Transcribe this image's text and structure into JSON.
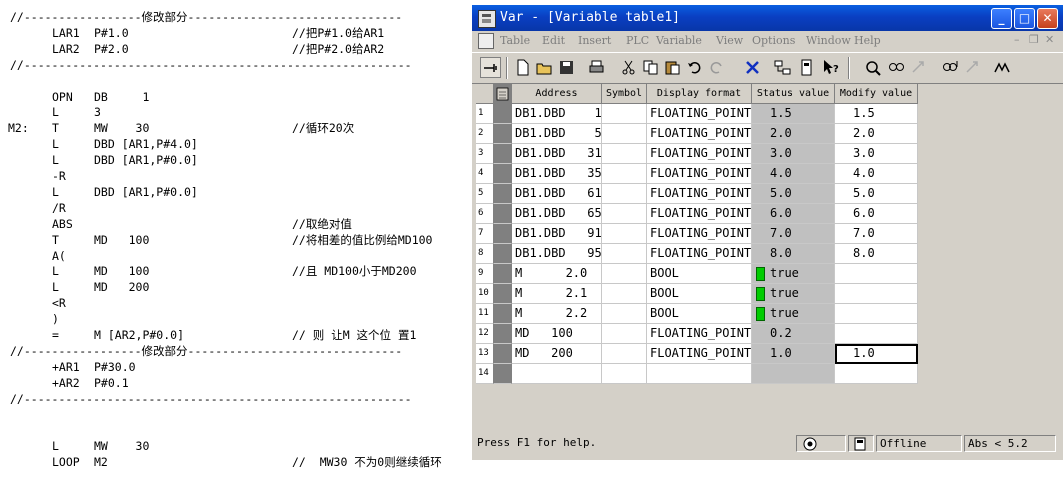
{
  "code_listing": [
    {
      "sep": "//-----------------修改部分-------------------------------"
    },
    {
      "op": "LAR1",
      "arg": "P#1.0",
      "comment": "//把P#1.0给AR1"
    },
    {
      "op": "LAR2",
      "arg": "P#2.0",
      "comment": "//把P#2.0给AR2"
    },
    {
      "sep": "//--------------------------------------------------------"
    },
    {},
    {
      "op": "OPN",
      "arg": "DB     1"
    },
    {
      "op": "L",
      "arg": "3"
    },
    {
      "label": "M2:",
      "op": "T",
      "arg": "MW    30",
      "comment": "//循环20次"
    },
    {
      "op": "L",
      "arg": "DBD [AR1,P#4.0]"
    },
    {
      "op": "L",
      "arg": "DBD [AR1,P#0.0]"
    },
    {
      "op": "-R"
    },
    {
      "op": "L",
      "arg": "DBD [AR1,P#0.0]"
    },
    {
      "op": "/R"
    },
    {
      "op": "ABS",
      "comment": "//取绝对值"
    },
    {
      "op": "T",
      "arg": "MD   100",
      "comment": "//将相差的值比例给MD100"
    },
    {
      "op": "A("
    },
    {
      "op": "L",
      "arg": "MD   100",
      "comment": "//且 MD100小于MD200"
    },
    {
      "op": "L",
      "arg": "MD   200"
    },
    {
      "op": "<R"
    },
    {
      "op": ")"
    },
    {
      "op": "=",
      "arg": "M [AR2,P#0.0]",
      "comment": "// 则 让M 这个位 置1"
    },
    {
      "sep": "//-----------------修改部分-------------------------------"
    },
    {
      "op": "+AR1",
      "arg": "P#30.0"
    },
    {
      "op": "+AR2",
      "arg": "P#0.1"
    },
    {
      "sep": "//--------------------------------------------------------"
    },
    {},
    {},
    {
      "op": "L",
      "arg": "MW    30"
    },
    {
      "op": "LOOP",
      "arg": "M2",
      "comment": "//  MW30 不为0则继续循环"
    }
  ],
  "window": {
    "title": "Var - [Variable table1]",
    "menus": [
      "Table",
      "Edit",
      "Insert",
      "PLC",
      "Variable",
      "View",
      "Options",
      "Window",
      "Help"
    ]
  },
  "columns": [
    "Address",
    "Symbol",
    "Display format",
    "Status value",
    "Modify value"
  ],
  "rows": [
    {
      "n": "1",
      "address": "DB1.DBD    1",
      "symbol": "",
      "format": "FLOATING_POINT",
      "status": "1.5",
      "led": false,
      "modify": "1.5"
    },
    {
      "n": "2",
      "address": "DB1.DBD    5",
      "symbol": "",
      "format": "FLOATING_POINT",
      "status": "2.0",
      "led": false,
      "modify": "2.0"
    },
    {
      "n": "3",
      "address": "DB1.DBD   31",
      "symbol": "",
      "format": "FLOATING_POINT",
      "status": "3.0",
      "led": false,
      "modify": "3.0"
    },
    {
      "n": "4",
      "address": "DB1.DBD   35",
      "symbol": "",
      "format": "FLOATING_POINT",
      "status": "4.0",
      "led": false,
      "modify": "4.0"
    },
    {
      "n": "5",
      "address": "DB1.DBD   61",
      "symbol": "",
      "format": "FLOATING_POINT",
      "status": "5.0",
      "led": false,
      "modify": "5.0"
    },
    {
      "n": "6",
      "address": "DB1.DBD   65",
      "symbol": "",
      "format": "FLOATING_POINT",
      "status": "6.0",
      "led": false,
      "modify": "6.0"
    },
    {
      "n": "7",
      "address": "DB1.DBD   91",
      "symbol": "",
      "format": "FLOATING_POINT",
      "status": "7.0",
      "led": false,
      "modify": "7.0"
    },
    {
      "n": "8",
      "address": "DB1.DBD   95",
      "symbol": "",
      "format": "FLOATING_POINT",
      "status": "8.0",
      "led": false,
      "modify": "8.0"
    },
    {
      "n": "9",
      "address": "M      2.0",
      "symbol": "",
      "format": "BOOL",
      "status": "true",
      "led": true,
      "modify": ""
    },
    {
      "n": "10",
      "address": "M      2.1",
      "symbol": "",
      "format": "BOOL",
      "status": "true",
      "led": true,
      "modify": ""
    },
    {
      "n": "11",
      "address": "M      2.2",
      "symbol": "",
      "format": "BOOL",
      "status": "true",
      "led": true,
      "modify": ""
    },
    {
      "n": "12",
      "address": "MD   100",
      "symbol": "",
      "format": "FLOATING_POINT",
      "status": "0.2",
      "led": false,
      "modify": ""
    },
    {
      "n": "13",
      "address": "MD   200",
      "symbol": "",
      "format": "FLOATING_POINT",
      "status": "1.0",
      "led": false,
      "modify": "1.0"
    },
    {
      "n": "14",
      "address": "",
      "symbol": "",
      "format": "",
      "status": "",
      "led": false,
      "modify": ""
    }
  ],
  "statusbar": {
    "help": "Press F1 for help.",
    "mode": "Offline",
    "abs": "Abs < 5.2"
  },
  "colors": {
    "title_blue": "#0a4fd8",
    "status_column": "#c0c0c0",
    "led_green": "#00cc00"
  }
}
